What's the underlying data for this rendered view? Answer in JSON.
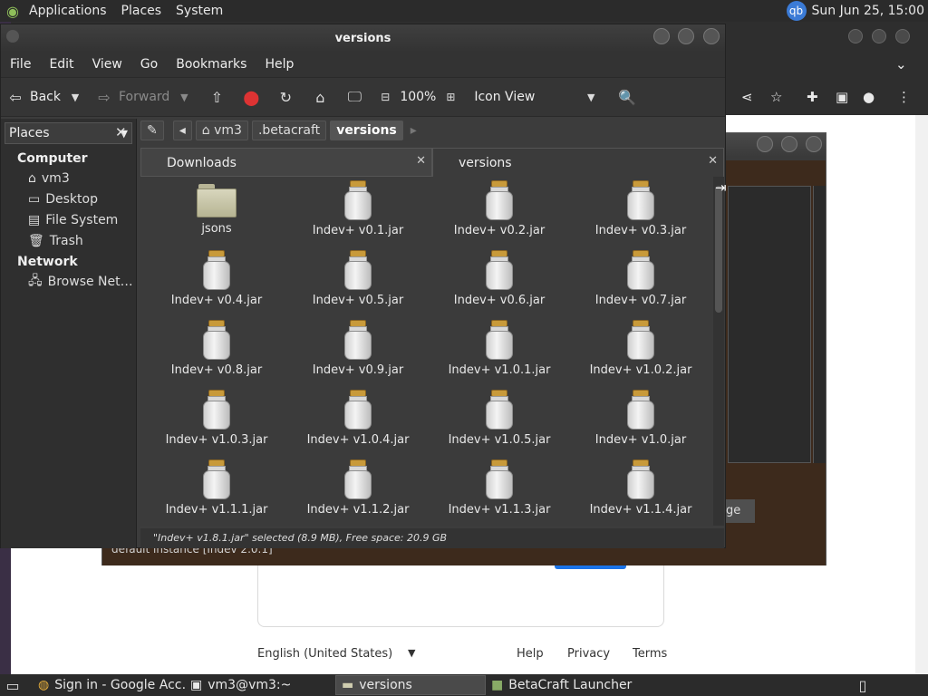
{
  "top_panel": {
    "menus": [
      "Applications",
      "Places",
      "System"
    ],
    "user_badge": "qb",
    "clock": "Sun Jun 25, 15:00"
  },
  "browser": {
    "footer": {
      "language": "English (United States)",
      "help": "Help",
      "privacy": "Privacy",
      "terms": "Terms"
    }
  },
  "betacraft": {
    "button_fragment": "age",
    "instance_text": "default instance [Indev 2.0.1]"
  },
  "file_manager": {
    "title": "versions",
    "menu": [
      "File",
      "Edit",
      "View",
      "Go",
      "Bookmarks",
      "Help"
    ],
    "toolbar": {
      "back": "Back",
      "forward": "Forward",
      "zoom": "100%",
      "view_mode": "Icon View"
    },
    "sidebar": {
      "selector": "Places",
      "sections": [
        {
          "heading": "Computer",
          "items": [
            {
              "label": "vm3",
              "icon": "home-icon"
            },
            {
              "label": "Desktop",
              "icon": "desktop-icon"
            },
            {
              "label": "File System",
              "icon": "drive-icon"
            },
            {
              "label": "Trash",
              "icon": "trash-icon"
            }
          ]
        },
        {
          "heading": "Network",
          "items": [
            {
              "label": "Browse Net…",
              "icon": "network-icon"
            }
          ]
        }
      ]
    },
    "path": [
      "vm3",
      ".betacraft",
      "versions"
    ],
    "tabs": [
      "Downloads",
      "versions"
    ],
    "files": [
      {
        "name": "jsons",
        "type": "folder"
      },
      {
        "name": "Indev+ v0.1.jar",
        "type": "jar"
      },
      {
        "name": "Indev+ v0.2.jar",
        "type": "jar"
      },
      {
        "name": "Indev+ v0.3.jar",
        "type": "jar"
      },
      {
        "name": "Indev+ v0.4.jar",
        "type": "jar"
      },
      {
        "name": "Indev+ v0.5.jar",
        "type": "jar"
      },
      {
        "name": "Indev+ v0.6.jar",
        "type": "jar"
      },
      {
        "name": "Indev+ v0.7.jar",
        "type": "jar"
      },
      {
        "name": "Indev+ v0.8.jar",
        "type": "jar"
      },
      {
        "name": "Indev+ v0.9.jar",
        "type": "jar"
      },
      {
        "name": "Indev+ v1.0.1.jar",
        "type": "jar"
      },
      {
        "name": "Indev+ v1.0.2.jar",
        "type": "jar"
      },
      {
        "name": "Indev+ v1.0.3.jar",
        "type": "jar"
      },
      {
        "name": "Indev+ v1.0.4.jar",
        "type": "jar"
      },
      {
        "name": "Indev+ v1.0.5.jar",
        "type": "jar"
      },
      {
        "name": "Indev+ v1.0.jar",
        "type": "jar"
      },
      {
        "name": "Indev+ v1.1.1.jar",
        "type": "jar"
      },
      {
        "name": "Indev+ v1.1.2.jar",
        "type": "jar"
      },
      {
        "name": "Indev+ v1.1.3.jar",
        "type": "jar"
      },
      {
        "name": "Indev+ v1.1.4.jar",
        "type": "jar"
      }
    ],
    "status": "\"Indev+ v1.8.1.jar\" selected (8.9 MB), Free space: 20.9 GB"
  },
  "taskbar": {
    "tasks": [
      {
        "label": "Sign in - Google Acc…",
        "icon": "chrome-icon"
      },
      {
        "label": "vm3@vm3:~",
        "icon": "terminal-icon"
      },
      {
        "label": "versions",
        "icon": "folder-icon",
        "active": true
      },
      {
        "label": "BetaCraft Launcher …",
        "icon": "betacraft-icon"
      }
    ]
  },
  "colors": {
    "accent_blue": "#1a73e8",
    "jar_lid": "#c89a3a",
    "panel_bg": "#2b2b2b"
  }
}
